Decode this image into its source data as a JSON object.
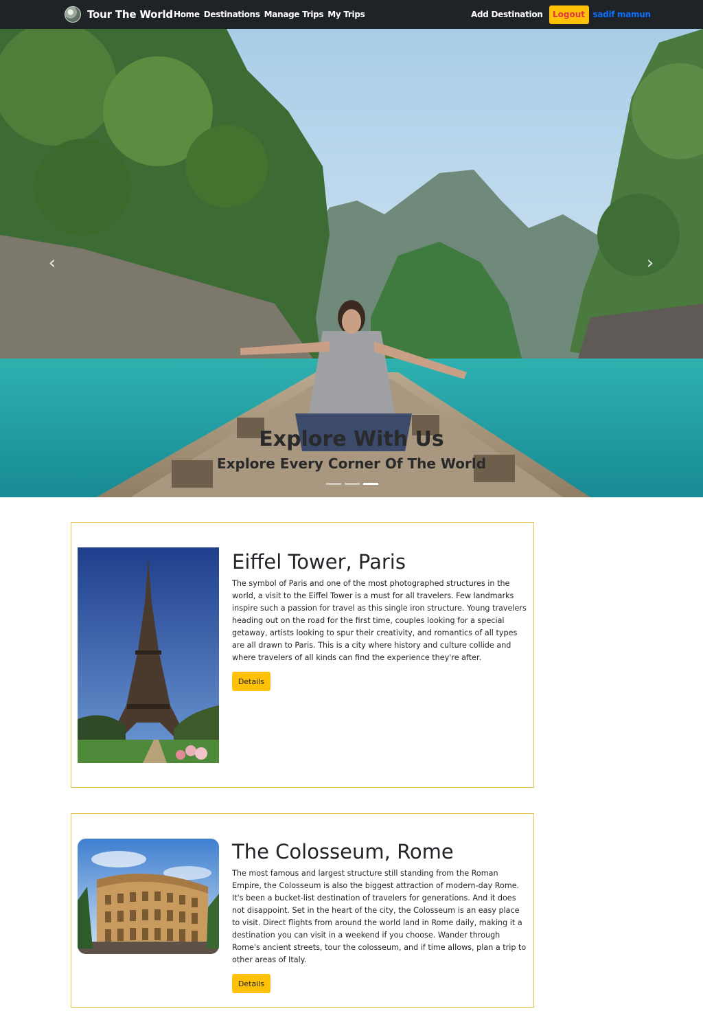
{
  "navbar": {
    "brand": "Tour The World",
    "links": [
      "Home",
      "Destinations",
      "Manage Trips",
      "My Trips"
    ],
    "add_destination": "Add Destination",
    "logout": "Logout",
    "user": "sadif mamun"
  },
  "hero": {
    "title": "Explore With Us",
    "subtitle": "Explore Every Corner Of The World",
    "prev_icon": "chevron-left-icon",
    "next_icon": "chevron-right-icon",
    "active_slide": 3,
    "slide_count": 3
  },
  "destinations": [
    {
      "title": "Eiffel Tower, Paris",
      "description": "The symbol of Paris and one of the most photographed structures in the world, a visit to the Eiffel Tower is a must for all travelers. Few landmarks inspire such a passion for travel as this single iron structure. Young travelers heading out on the road for the first time, couples looking for a special getaway, artists looking to spur their creativity, and romantics of all types are all drawn to Paris. This is a city where history and culture collide and where travelers of all kinds can find the experience they're after.",
      "button": "Details"
    },
    {
      "title": "The Colosseum, Rome",
      "description": "The most famous and largest structure still standing from the Roman Empire, the Colosseum is also the biggest attraction of modern-day Rome. It's been a bucket-list destination of travelers for generations. And it does not disappoint. Set in the heart of the city, the Colosseum is an easy place to visit. Direct flights from around the world land in Rome daily, making it a destination you can visit in a weekend if you choose. Wander through Rome's ancient streets, tour the colosseum, and if time allows, plan a trip to other areas of Italy.",
      "button": "Details"
    }
  ],
  "colors": {
    "navbar_bg": "#1f2226",
    "accent": "#ffc107",
    "logout_text": "#dc3545",
    "user_link": "#0d6efd",
    "card_border": "#e8c04a"
  }
}
